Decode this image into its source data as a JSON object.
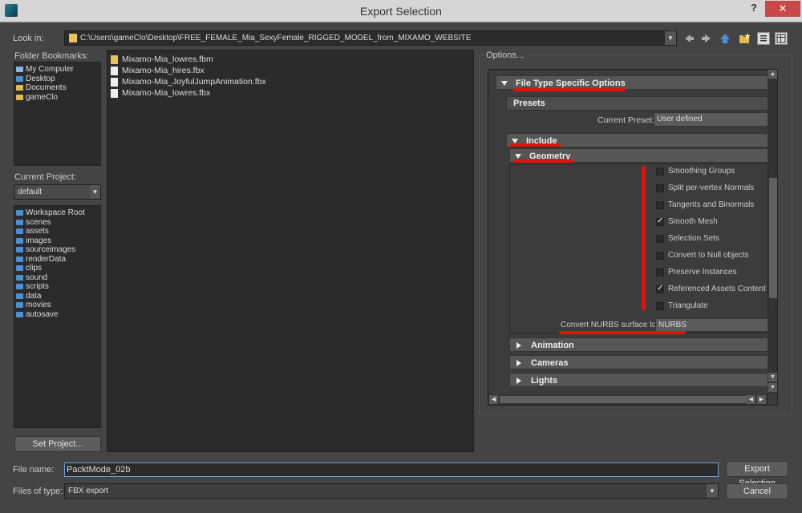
{
  "window": {
    "title": "Export Selection",
    "help": "?",
    "close": "✕"
  },
  "look_in": {
    "label": "Look in:",
    "path": "C:\\Users\\gameClo\\Desktop\\FREE_FEMALE_Mia_SexyFemale_RIGGED_MODEL_from_MIXAMO_WEBSITE"
  },
  "bookmarks": {
    "label": "Folder Bookmarks:",
    "items": [
      "My Computer",
      "Desktop",
      "Documents",
      "gameClo"
    ]
  },
  "project": {
    "label": "Current Project:",
    "value": "default",
    "folders": [
      "Workspace Root",
      "scenes",
      "assets",
      "images",
      "sourceimages",
      "renderData",
      "clips",
      "sound",
      "scripts",
      "data",
      "movies",
      "autosave"
    ],
    "set_button": "Set Project..."
  },
  "files": [
    "Mixamo-Mia_lowres.fbm",
    "Mixamo-Mia_hires.fbx",
    "Mixamo-Mia_JoyfulJumpAnimation.fbx",
    "Mixamo-Mia_lowres.fbx"
  ],
  "options": {
    "label": "Options...",
    "file_type_section": "File Type Specific Options",
    "presets_label": "Presets",
    "current_preset_label": "Current Preset:",
    "current_preset_value": "User defined",
    "include": "Include",
    "geometry": "Geometry",
    "checks": [
      {
        "label": "Smoothing Groups",
        "checked": false
      },
      {
        "label": "Split per-vertex Normals",
        "checked": false
      },
      {
        "label": "Tangents and Binormals",
        "checked": false
      },
      {
        "label": "Smooth Mesh",
        "checked": true
      },
      {
        "label": "Selection Sets",
        "checked": false
      },
      {
        "label": "Convert to Null objects",
        "checked": false
      },
      {
        "label": "Preserve Instances",
        "checked": false
      },
      {
        "label": "Referenced Assets Content",
        "checked": true
      },
      {
        "label": "Triangulate",
        "checked": false
      }
    ],
    "nurbs_label": "Convert NURBS surface to:",
    "nurbs_value": "NURBS",
    "animation": "Animation",
    "cameras": "Cameras",
    "lights": "Lights"
  },
  "bottom": {
    "file_name_label": "File name:",
    "file_name_value": "PacktMode_02b",
    "file_type_label": "Files of type:",
    "file_type_value": "FBX export",
    "export_button": "Export Selection",
    "cancel_button": "Cancel"
  },
  "colors": {
    "annotation_red": "#e3120b",
    "close_red": "#c94848"
  }
}
